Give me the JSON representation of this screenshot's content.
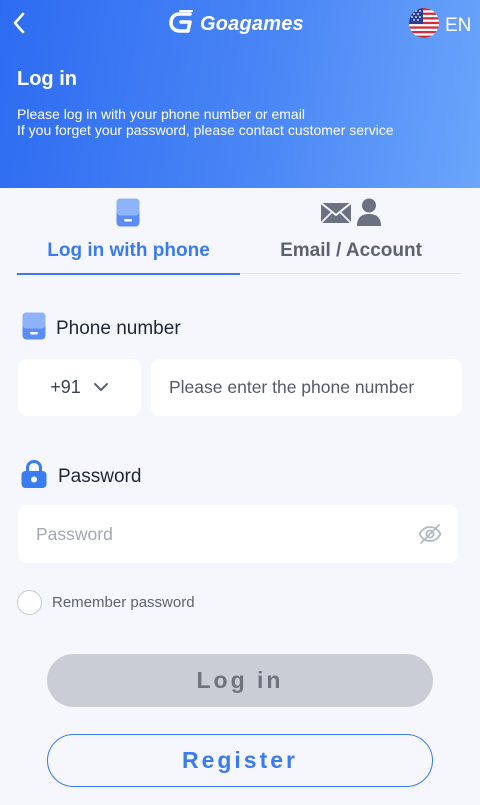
{
  "header": {
    "brand": "Goagames",
    "language": "EN",
    "title": "Log in",
    "subtitle_line1": "Please log in with your phone number or email",
    "subtitle_line2": "If you forget your password, please contact customer service"
  },
  "tabs": [
    {
      "label": "Log in with phone",
      "active": true
    },
    {
      "label": "Email / Account",
      "active": false
    }
  ],
  "phone": {
    "label": "Phone number",
    "country_code": "+91",
    "placeholder": "Please enter the phone number",
    "value": ""
  },
  "password": {
    "label": "Password",
    "placeholder": "Password",
    "value": ""
  },
  "remember": {
    "label": "Remember password",
    "checked": false
  },
  "buttons": {
    "login": "Log in",
    "register": "Register"
  },
  "colors": {
    "accent": "#3a7bf0",
    "header_start": "#2d6bf2",
    "header_end": "#6aa6fb",
    "disabled_button": "#cbcdd6"
  },
  "icons": [
    "back-arrow-icon",
    "brand-logo-icon",
    "us-flag-icon",
    "phone-icon",
    "mail-icon",
    "person-icon",
    "lock-icon",
    "eye-off-icon",
    "chevron-down-icon"
  ]
}
